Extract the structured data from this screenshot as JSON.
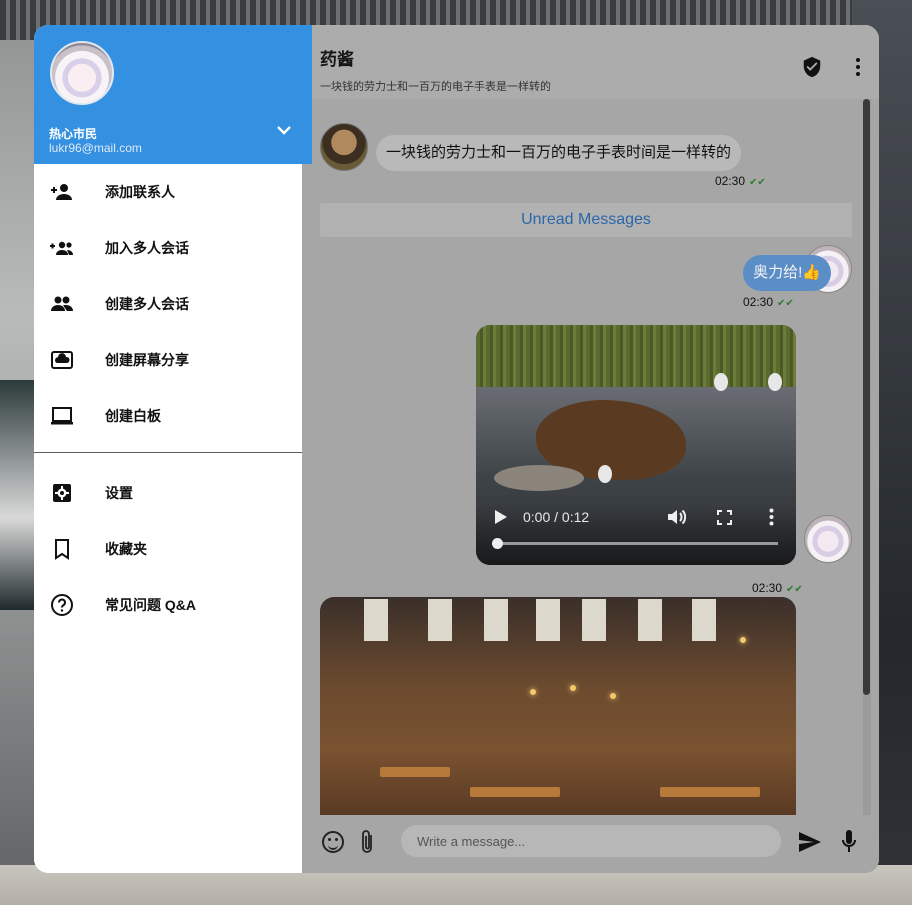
{
  "drawer": {
    "user_name": "热心市民",
    "user_email": "lukr96@mail.com",
    "menu_top": [
      {
        "label": "添加联系人",
        "icon": "person-add-icon"
      },
      {
        "label": "加入多人会话",
        "icon": "group-add-icon"
      },
      {
        "label": "创建多人会话",
        "icon": "group-icon"
      },
      {
        "label": "创建屏幕分享",
        "icon": "screen-share-icon"
      },
      {
        "label": "创建白板",
        "icon": "laptop-icon"
      }
    ],
    "menu_bottom": [
      {
        "label": "设置",
        "icon": "settings-icon"
      },
      {
        "label": "收藏夹",
        "icon": "bookmark-icon"
      },
      {
        "label": "常见问题 Q&A",
        "icon": "help-icon"
      }
    ]
  },
  "chat": {
    "title": "药酱",
    "subtitle": "一块钱的劳力士和一百万的电子手表是一样转的",
    "messages": {
      "incoming_text": "一块钱的劳力士和一百万的电子手表时间是一样转的",
      "incoming_time": "02:30",
      "unread_label": "Unread Messages",
      "outgoing_text": "奥力给!👍",
      "outgoing_time": "02:30",
      "video_time_display": "0:00 / 0:12",
      "video_sent_time": "02:30"
    },
    "composer": {
      "placeholder": "Write a message..."
    }
  },
  "colors": {
    "drawer_header": "#3490e1",
    "outgoing_bubble": "#5b8ec6",
    "unread_text": "#2b67a8"
  }
}
